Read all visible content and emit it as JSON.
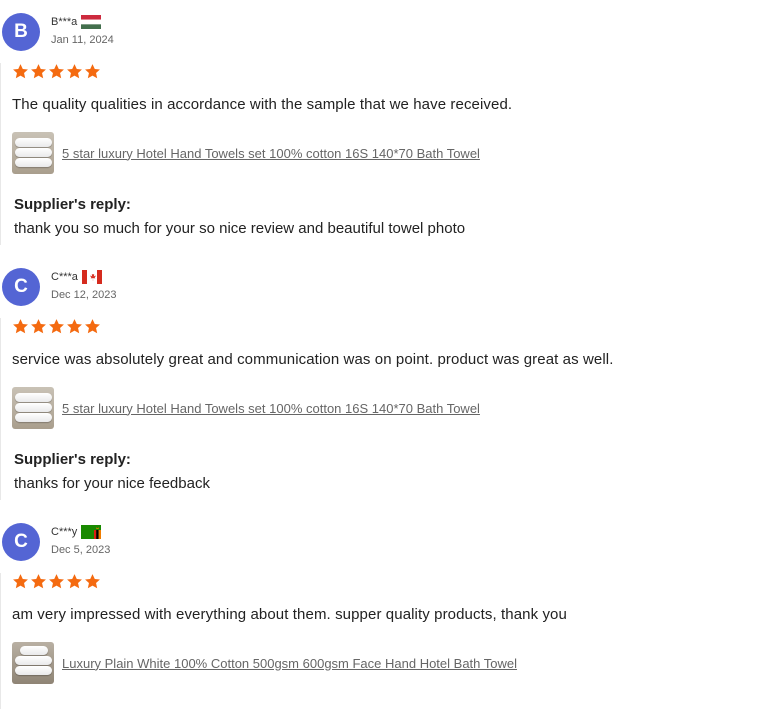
{
  "colors": {
    "avatar_bg": "#5465d4",
    "star": "#f46a10",
    "link": "#666666"
  },
  "reviews": [
    {
      "avatar_letter": "B",
      "name": "B***a",
      "flag": "hungary-flag",
      "date": "Jan 11, 2024",
      "rating": 5,
      "comment": "The quality qualities in accordance with the sample that we have received.",
      "product": "5 star luxury Hotel Hand Towels set 100% cotton 16S 140*70 Bath Towel",
      "reply_title": "Supplier's reply:",
      "reply_text": "thank you so much for your so nice review and beautiful towel photo"
    },
    {
      "avatar_letter": "C",
      "name": "C***a",
      "flag": "canada-flag",
      "date": "Dec 12, 2023",
      "rating": 5,
      "comment": "service was absolutely great and communication was on point. product was great as well.",
      "product": "5 star luxury Hotel Hand Towels set 100% cotton 16S 140*70 Bath Towel",
      "reply_title": "Supplier's reply:",
      "reply_text": "thanks for your nice feedback"
    },
    {
      "avatar_letter": "C",
      "name": "C***y",
      "flag": "zambia-flag",
      "date": "Dec 5, 2023",
      "rating": 5,
      "comment": "am very impressed with everything about them. supper quality products, thank you",
      "product": "Luxury Plain White 100% Cotton 500gsm 600gsm Face Hand Hotel Bath Towel"
    }
  ]
}
